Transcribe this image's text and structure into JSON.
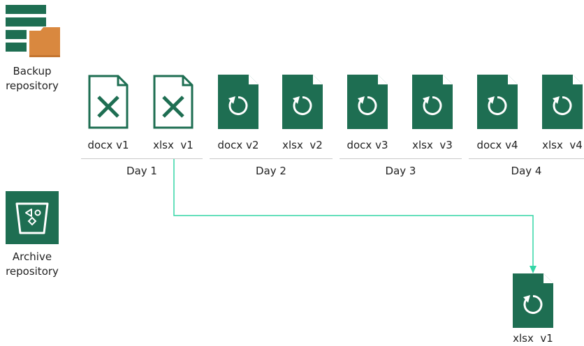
{
  "repositories": {
    "backup": {
      "label_line1": "Backup",
      "label_line2": "repository",
      "icon": "backup-repository-icon"
    },
    "archive": {
      "label_line1": "Archive",
      "label_line2": "repository",
      "icon": "archive-repository-icon"
    }
  },
  "files": [
    {
      "label": "docx v1",
      "icon": "deleted-file-icon"
    },
    {
      "label": "xlsx  v1",
      "icon": "deleted-file-icon"
    },
    {
      "label": "docx v2",
      "icon": "restore-file-icon"
    },
    {
      "label": "xlsx  v2",
      "icon": "restore-file-icon"
    },
    {
      "label": "docx v3",
      "icon": "restore-file-icon"
    },
    {
      "label": "xlsx  v3",
      "icon": "restore-file-icon"
    },
    {
      "label": "docx v4",
      "icon": "restore-file-icon"
    },
    {
      "label": "xlsx  v4",
      "icon": "restore-file-icon"
    }
  ],
  "days": [
    "Day 1",
    "Day 2",
    "Day 3",
    "Day 4"
  ],
  "archived_file": {
    "label": "xlsx  v1",
    "icon": "restore-file-icon"
  },
  "colors": {
    "file_green": "#1e6e52",
    "folder_orange": "#d9883f",
    "connector": "#33d6a6",
    "divider": "#c8c8c8"
  }
}
